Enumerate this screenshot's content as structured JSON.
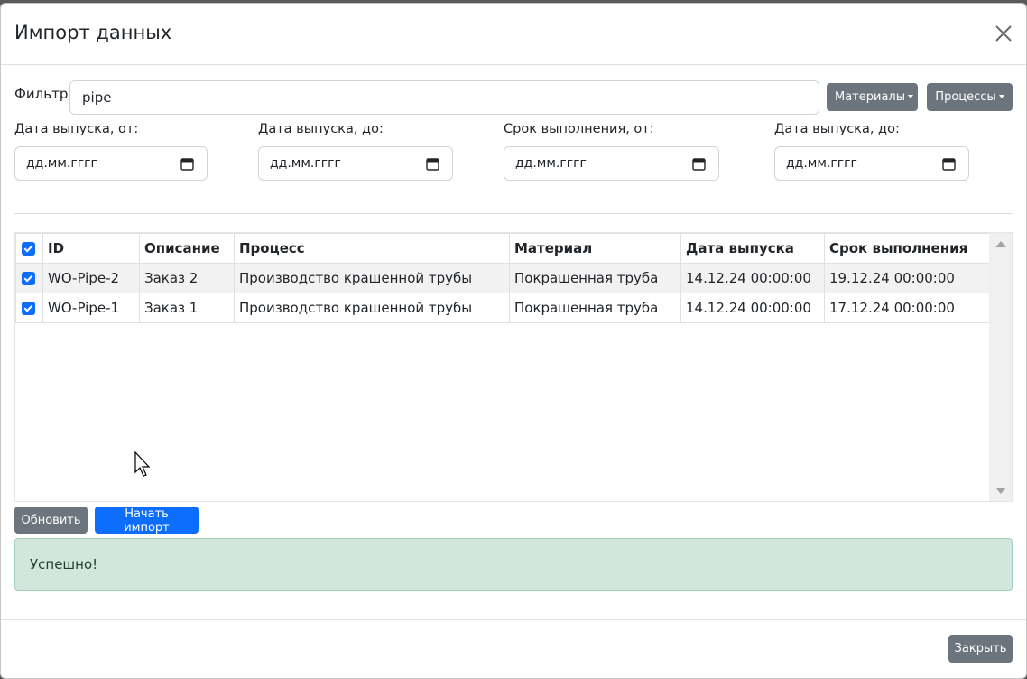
{
  "modal": {
    "title": "Импорт данных",
    "close_icon": "close-icon"
  },
  "filter": {
    "label": "Фильтр",
    "value": "pipe",
    "materials_label": "Материалы",
    "processes_label": "Процессы"
  },
  "dates": [
    {
      "label": "Дата выпуска, от:",
      "placeholder": "дд.мм.гггг"
    },
    {
      "label": "Дата выпуска, до:",
      "placeholder": "дд.мм.гггг"
    },
    {
      "label": "Срок выполнения, от:",
      "placeholder": "дд.мм.гггг"
    },
    {
      "label": "Дата выпуска, до:",
      "placeholder": "дд.мм.гггг"
    }
  ],
  "table": {
    "headers": [
      "ID",
      "Описание",
      "Процесс",
      "Материал",
      "Дата выпуска",
      "Срок выполнения"
    ],
    "header_checked": true,
    "rows": [
      {
        "checked": true,
        "id": "WO-Pipe-2",
        "description": "Заказ 2",
        "process": "Производство крашенной трубы",
        "material": "Покрашенная труба",
        "release": "14.12.24 00:00:00",
        "due": "19.12.24 00:00:00"
      },
      {
        "checked": true,
        "id": "WO-Pipe-1",
        "description": "Заказ 1",
        "process": "Производство крашенной трубы",
        "material": "Покрашенная труба",
        "release": "14.12.24 00:00:00",
        "due": "17.12.24 00:00:00"
      }
    ]
  },
  "actions": {
    "refresh_label": "Обновить",
    "start_label": "Начать импорт"
  },
  "alert": {
    "text": "Успешно!"
  },
  "footer": {
    "close_label": "Закрыть"
  },
  "colors": {
    "primary": "#0d6efd",
    "secondary": "#6c757d",
    "success_bg": "#d1e7dd"
  }
}
